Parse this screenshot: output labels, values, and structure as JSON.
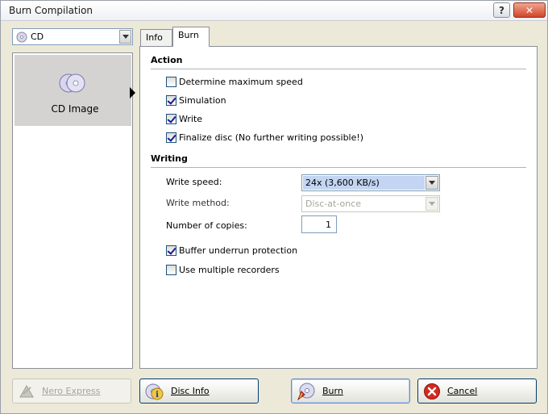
{
  "window": {
    "title": "Burn Compilation",
    "help_glyph": "?",
    "close_glyph": "✕"
  },
  "left": {
    "media_combo": {
      "value": "CD"
    },
    "items": [
      {
        "label": "CD Image",
        "icon": "cd-image-icon",
        "selected": true
      }
    ]
  },
  "tabs": [
    {
      "label": "Info",
      "active": false
    },
    {
      "label": "Burn",
      "active": true
    }
  ],
  "action": {
    "heading": "Action",
    "options": [
      {
        "label": "Determine maximum speed",
        "checked": false
      },
      {
        "label": "Simulation",
        "checked": true
      },
      {
        "label": "Write",
        "checked": true
      },
      {
        "label": "Finalize disc (No further writing possible!)",
        "checked": true
      }
    ]
  },
  "writing": {
    "heading": "Writing",
    "write_speed_label": "Write speed:",
    "write_speed_value": "24x (3,600 KB/s)",
    "write_method_label": "Write method:",
    "write_method_value": "Disc-at-once",
    "copies_label": "Number of copies:",
    "copies_value": "1",
    "options": [
      {
        "label": "Buffer underrun protection",
        "checked": true
      },
      {
        "label": "Use multiple recorders",
        "checked": false
      }
    ]
  },
  "buttons": {
    "nero_express": "Nero Express",
    "disc_info": "Disc Info",
    "burn": "Burn",
    "cancel": "Cancel"
  },
  "colors": {
    "accent_selection": "#c3d5f2",
    "cancel_red": "#d42a1f"
  }
}
